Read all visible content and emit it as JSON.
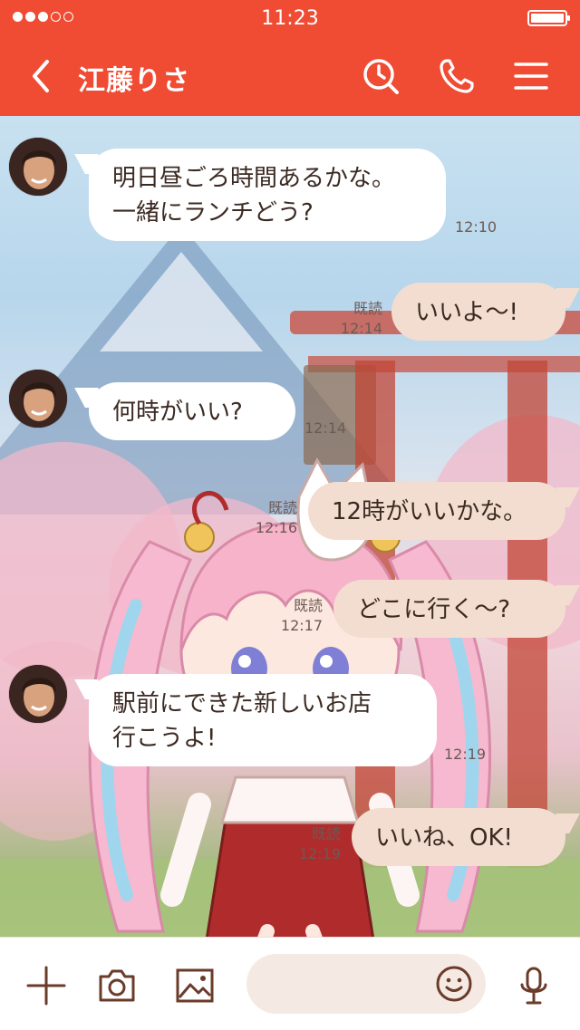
{
  "status_bar": {
    "time": "11:23",
    "signal_bars": 3,
    "signal_total": 5,
    "battery_level": 1.0
  },
  "header": {
    "title": "江藤りさ",
    "icons": [
      "chevron-left-icon",
      "clock-search-icon",
      "phone-icon",
      "menu-icon"
    ]
  },
  "messages": [
    {
      "side": "in",
      "lines": [
        "明日昼ごろ時間あるかな。",
        "一緒にランチどう?"
      ],
      "time": "12:10"
    },
    {
      "side": "out",
      "lines": [
        "いいよ〜!"
      ],
      "read": "既読",
      "time": "12:14"
    },
    {
      "side": "in",
      "lines": [
        "何時がいい?"
      ],
      "time": "12:14"
    },
    {
      "side": "out",
      "lines": [
        "12時がいいかな。"
      ],
      "read": "既読",
      "time": "12:16"
    },
    {
      "side": "out",
      "lines": [
        "どこに行く〜?"
      ],
      "read": "既読",
      "time": "12:17"
    },
    {
      "side": "in",
      "lines": [
        "駅前にできた新しいお店",
        "行こうよ!"
      ],
      "time": "12:19"
    },
    {
      "side": "out",
      "lines": [
        "いいね、OK!"
      ],
      "read": "既読",
      "time": "12:19"
    }
  ],
  "footer": {
    "icons": [
      "plus-icon",
      "camera-icon",
      "image-icon",
      "smile-icon",
      "microphone-icon"
    ],
    "input_value": "",
    "input_placeholder": ""
  },
  "colors": {
    "brand": "#f04b33",
    "icon": "#6b3b2a",
    "outgoing_bubble": "#f3ddd0",
    "incoming_bubble": "#ffffff"
  }
}
